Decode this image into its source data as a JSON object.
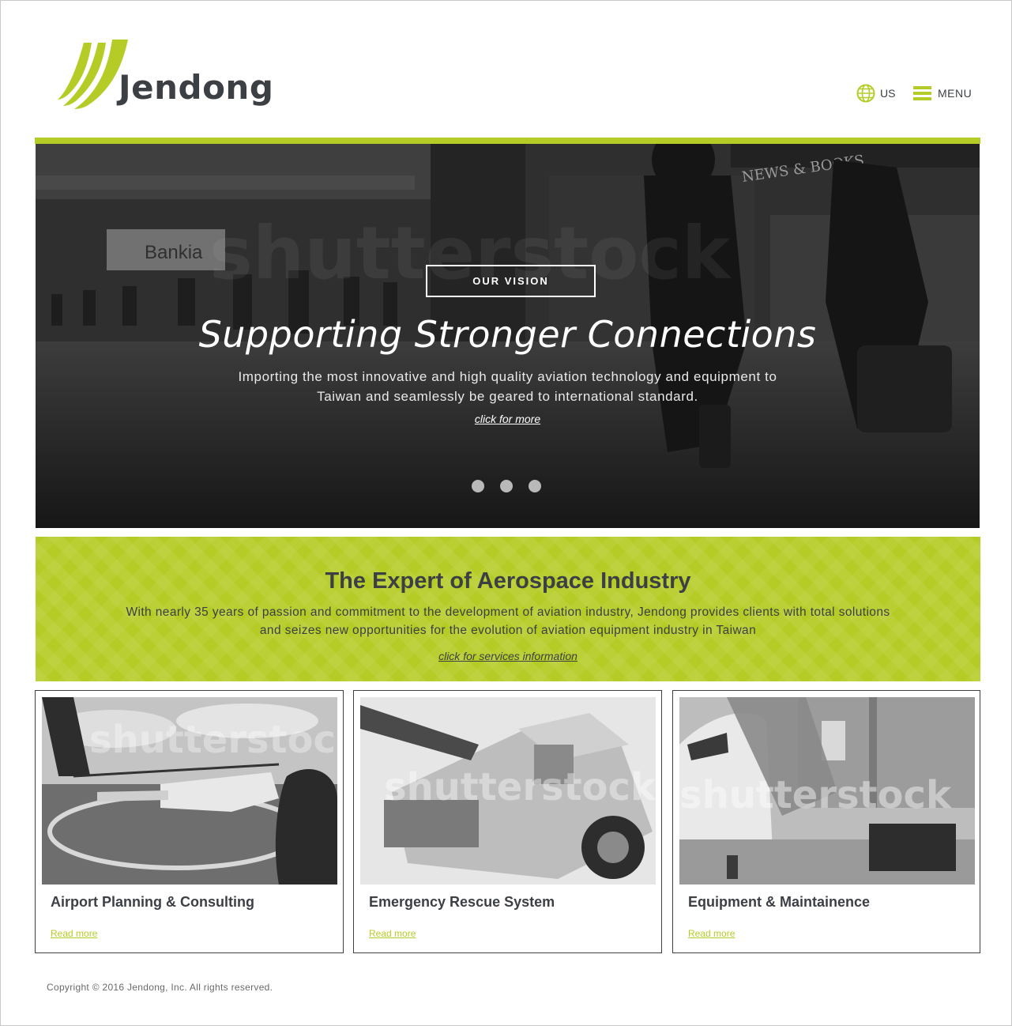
{
  "header": {
    "brand_name": "Jendong",
    "language_label": "US",
    "menu_label": "MENU",
    "icons": [
      "globe-icon",
      "hamburger-icon"
    ]
  },
  "hero": {
    "button_label": "OUR VISION",
    "title": "Supporting Stronger Connections",
    "description": "Importing the most innovative and high quality aviation technology and equipment to Taiwan and seamlessly be geared to international standard.",
    "link_label": "click for more",
    "background_signs": [
      "Bankia",
      "NEWS & BOOKS"
    ],
    "watermark": "shutterstock",
    "slides_count": 3
  },
  "band": {
    "title": "The Expert of Aerospace Industry",
    "description": "With nearly 35 years of passion and commitment to the development of aviation industry, Jendong provides clients with total solutions and seizes new opportunities for the evolution of aviation equipment industry in Taiwan",
    "link_label": "click for services information"
  },
  "services": [
    {
      "title": "Airport Planning & Consulting",
      "link_label": "Read more",
      "image": "helicopter-photo"
    },
    {
      "title": "Emergency Rescue System",
      "link_label": "Read more",
      "image": "rescue-vehicle-photo"
    },
    {
      "title": "Equipment & Maintainence",
      "link_label": "Read more",
      "image": "airplane-jet-bridge-photo"
    }
  ],
  "footer": {
    "copyright": "Copyright © 2016 Jendong, Inc. All rights reserved."
  },
  "colors": {
    "accent": "#b5cc27",
    "text": "#3c3f44",
    "hero_overlay": "#2e2e2e"
  }
}
